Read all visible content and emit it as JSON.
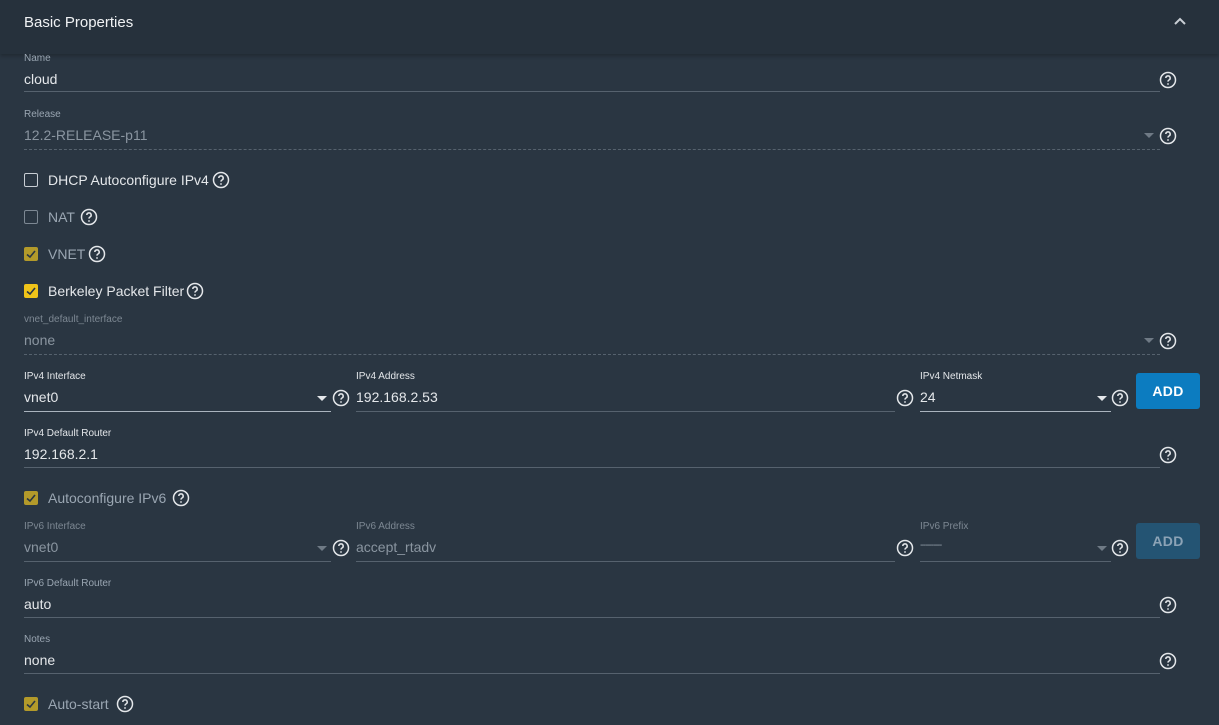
{
  "section": {
    "title": "Basic Properties"
  },
  "icons": {
    "help": "help-circle-icon",
    "collapse": "chevron-up-icon",
    "dropdown": "caret-down-icon",
    "check": "check-icon"
  },
  "colors": {
    "accent_checkbox": "#f0c419",
    "primary_button": "#0c7cc0",
    "background": "#2a3642"
  },
  "name": {
    "label": "Name",
    "value": "cloud"
  },
  "release": {
    "label": "Release",
    "value": "12.2-RELEASE-p11"
  },
  "checkboxes": {
    "dhcp": {
      "label": "DHCP Autoconfigure IPv4",
      "checked": false
    },
    "nat": {
      "label": "NAT",
      "checked": false
    },
    "vnet": {
      "label": "VNET",
      "checked": true
    },
    "bpf": {
      "label": "Berkeley Packet Filter",
      "checked": true
    },
    "autoconf_ipv6": {
      "label": "Autoconfigure IPv6",
      "checked": true
    },
    "autostart": {
      "label": "Auto-start",
      "checked": true
    }
  },
  "vnet_default_interface": {
    "label": "vnet_default_interface",
    "value": "none"
  },
  "ipv4": {
    "interface": {
      "label": "IPv4 Interface",
      "value": "vnet0"
    },
    "address": {
      "label": "IPv4 Address",
      "value": "192.168.2.53"
    },
    "netmask": {
      "label": "IPv4 Netmask",
      "value": "24"
    },
    "add_label": "ADD"
  },
  "ipv4_default_router": {
    "label": "IPv4 Default Router",
    "value": "192.168.2.1"
  },
  "ipv6": {
    "interface": {
      "label": "IPv6 Interface",
      "value": "vnet0"
    },
    "address": {
      "label": "IPv6 Address",
      "value": "accept_rtadv"
    },
    "prefix": {
      "label": "IPv6 Prefix",
      "value": "--------"
    },
    "add_label": "ADD"
  },
  "ipv6_default_router": {
    "label": "IPv6 Default Router",
    "value": "auto"
  },
  "notes": {
    "label": "Notes",
    "value": "none"
  }
}
